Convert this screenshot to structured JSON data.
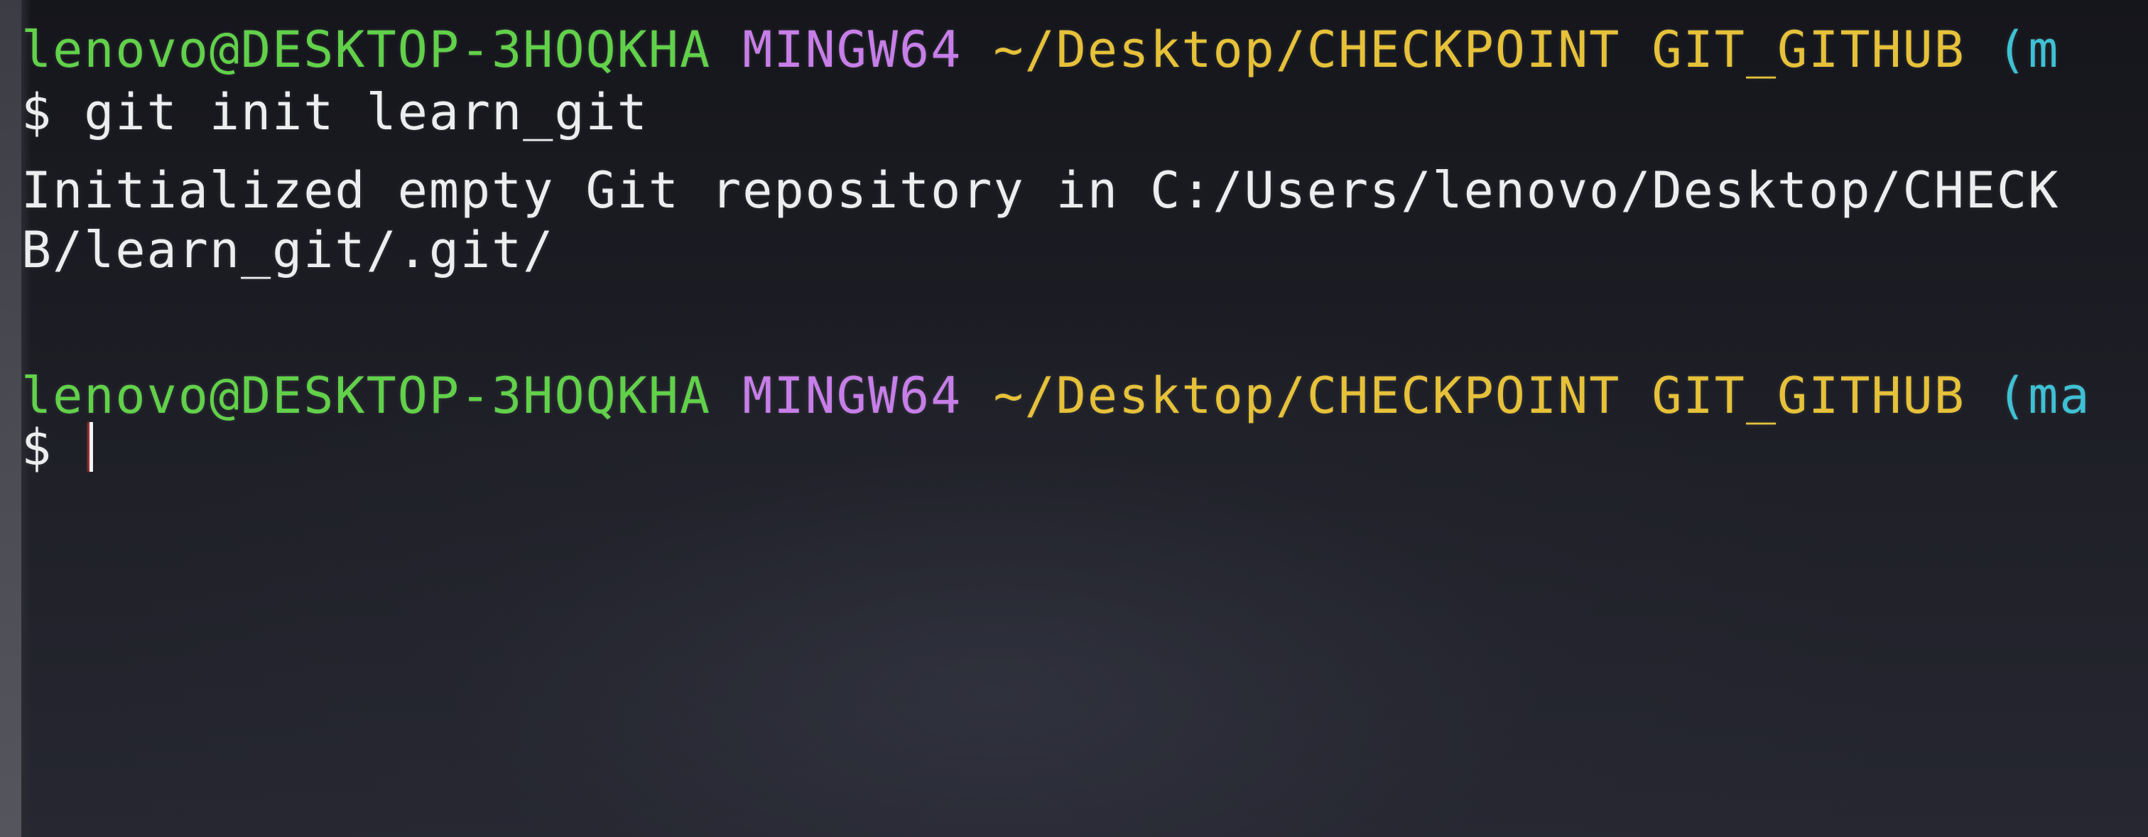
{
  "terminal": {
    "prompt1": {
      "user": "lenovo@DESKTOP-3HOQKHA",
      "env": "MINGW64",
      "path": "~/Desktop/CHECKPOINT GIT_GITHUB",
      "branch": "(m"
    },
    "command1": "$ git init learn_git",
    "output1_line1": "Initialized empty Git repository in C:/Users/lenovo/Desktop/CHECK",
    "output1_line2": "B/learn_git/.git/",
    "prompt2": {
      "user": "lenovo@DESKTOP-3HOQKHA",
      "env": "MINGW64",
      "path": "~/Desktop/CHECKPOINT GIT_GITHUB",
      "branch": "(ma"
    },
    "prompt_symbol": "$",
    "colors": {
      "user": "#61d14a",
      "env": "#c77ee8",
      "path": "#e6c139",
      "branch": "#3fc1d4",
      "text": "#ecedef",
      "background": "#1b1c23"
    }
  }
}
